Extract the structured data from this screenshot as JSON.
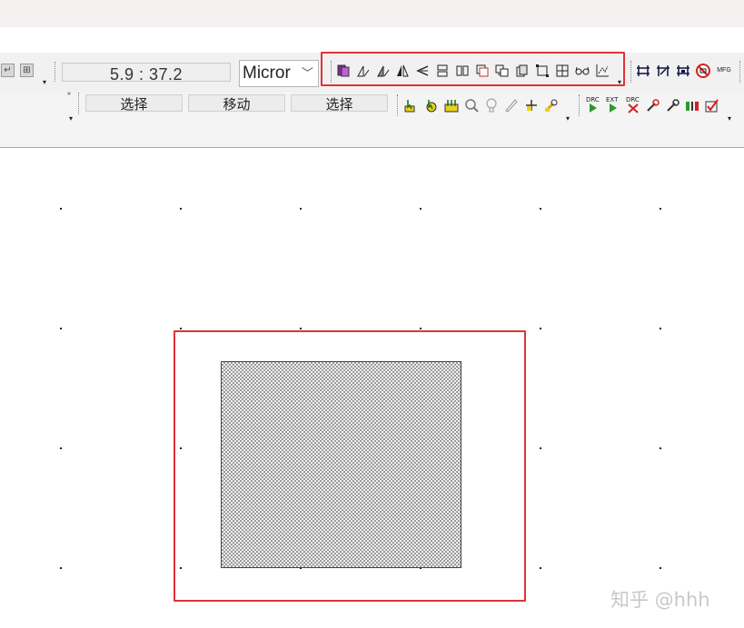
{
  "toolbar": {
    "coordinate": "5.9 : 37.2",
    "unit_select": {
      "selected": "Micror"
    },
    "mode_buttons": [
      "选择",
      "移动",
      "选择"
    ],
    "group1_icons": [
      "layer-icon",
      "rotate-left-icon",
      "rotate-right-icon",
      "mirror-x-icon",
      "mirror-y-icon",
      "align-top-icon",
      "align-left-icon",
      "copy-icon",
      "paste-icon",
      "duplicate-icon",
      "stretch-icon",
      "group-icon",
      "glasses-icon",
      "chart-icon"
    ],
    "group2_icons": [
      "snap-grid-icon",
      "snap-point-icon",
      "snap-edge-icon",
      "no-snap-icon",
      "mfg-icon"
    ],
    "group3_icons": [
      "select-area-icon",
      "select-object-icon",
      "select-all-icon",
      "zoom-icon",
      "bulb-icon",
      "pen-icon",
      "crossing-icon",
      "wrench-tool-icon"
    ],
    "group4_icons": [
      "drc-run-icon",
      "ext-run-icon",
      "drc-clear-icon",
      "wrench-1-icon",
      "wrench-2-icon",
      "marker-icon",
      "check-icon"
    ],
    "drc_label": "DRC",
    "ext_label": "EXT",
    "mfg_label": "MFG"
  },
  "watermark": "知乎 @hhh"
}
